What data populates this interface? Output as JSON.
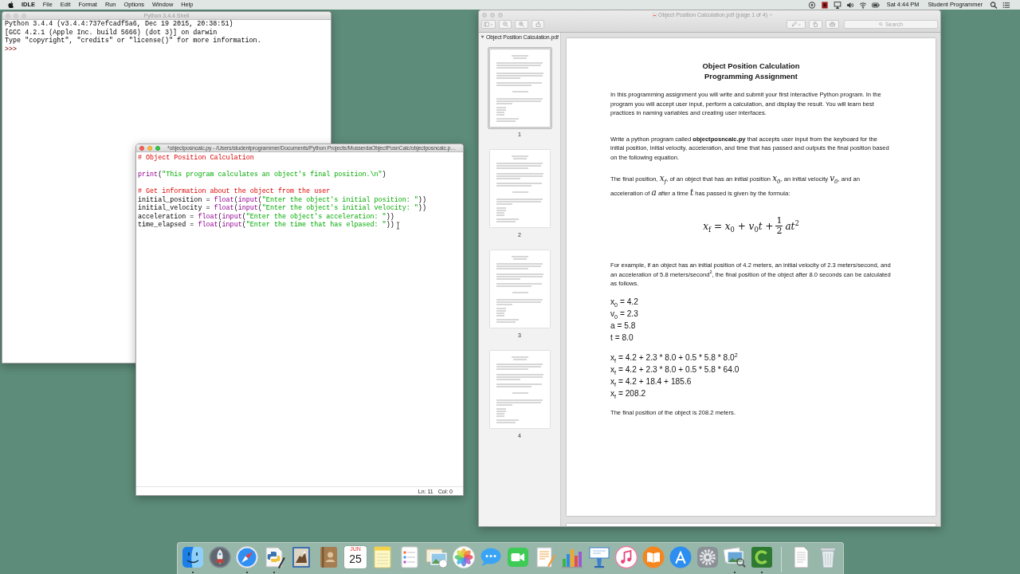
{
  "menu_bar": {
    "app": "IDLE",
    "menus": [
      "File",
      "Edit",
      "Format",
      "Run",
      "Options",
      "Window",
      "Help"
    ],
    "clock": "Sat 4:44 PM",
    "user": "Student Programmer"
  },
  "shell": {
    "title": "Python 3.4.4 Shell",
    "active": false,
    "lines": [
      "Python 3.4.4 (v3.4.4:737efcadf5a6, Dec 19 2015, 20:38:51)",
      "[GCC 4.2.1 (Apple Inc. build 5666) (dot 3)] on darwin",
      "Type \"copyright\", \"credits\" or \"license()\" for more information."
    ],
    "prompt": ">>>"
  },
  "editor": {
    "title": "*objectposncalc.py - /Users/studentprogrammer/Documents/Python Projects/MusserdaObjectPosnCalc/objectposncalc.p…",
    "active": true,
    "blocks": [
      [
        [
          {
            "kind": "comment",
            "text": "# Object Position Calculation"
          }
        ]
      ],
      [
        [
          {
            "kind": "builtin",
            "text": "print"
          },
          {
            "kind": "plain",
            "text": "("
          },
          {
            "kind": "string",
            "text": "\"This program calculates an object's final position.\\n\""
          },
          {
            "kind": "plain",
            "text": ")"
          }
        ]
      ],
      [
        [
          {
            "kind": "comment",
            "text": "# Get information about the object from the user"
          }
        ],
        [
          {
            "kind": "plain",
            "text": "initial_position = "
          },
          {
            "kind": "builtin",
            "text": "float"
          },
          {
            "kind": "plain",
            "text": "("
          },
          {
            "kind": "builtin",
            "text": "input"
          },
          {
            "kind": "plain",
            "text": "("
          },
          {
            "kind": "string",
            "text": "\"Enter the object's initial position: \""
          },
          {
            "kind": "plain",
            "text": "))"
          }
        ],
        [
          {
            "kind": "plain",
            "text": "initial_velocity = "
          },
          {
            "kind": "builtin",
            "text": "float"
          },
          {
            "kind": "plain",
            "text": "("
          },
          {
            "kind": "builtin",
            "text": "input"
          },
          {
            "kind": "plain",
            "text": "("
          },
          {
            "kind": "string",
            "text": "\"Enter the object's initial velocity: \""
          },
          {
            "kind": "plain",
            "text": "))"
          }
        ],
        [
          {
            "kind": "plain",
            "text": "acceleration = "
          },
          {
            "kind": "builtin",
            "text": "float"
          },
          {
            "kind": "plain",
            "text": "("
          },
          {
            "kind": "builtin",
            "text": "input"
          },
          {
            "kind": "plain",
            "text": "("
          },
          {
            "kind": "string",
            "text": "\"Enter the object's acceleration: \""
          },
          {
            "kind": "plain",
            "text": "))"
          }
        ],
        [
          {
            "kind": "plain",
            "text": "time_elapsed = "
          },
          {
            "kind": "builtin",
            "text": "float"
          },
          {
            "kind": "plain",
            "text": "("
          },
          {
            "kind": "builtin",
            "text": "input"
          },
          {
            "kind": "plain",
            "text": "("
          },
          {
            "kind": "string",
            "text": "\"Enter the time that has elpased: \""
          },
          {
            "kind": "plain",
            "text": "))"
          }
        ]
      ]
    ],
    "status": {
      "line": "Ln: 11",
      "column": "Col: 0"
    }
  },
  "preview": {
    "title": "Object Position Calculation.pdf (page 1 of 4)",
    "active": false,
    "search": {
      "placeholder": "Search"
    },
    "sidebar": {
      "document": "Object Position Calculation.pdf",
      "expanded": true,
      "pages": [
        {
          "label": "1",
          "selected": true
        },
        {
          "label": "2",
          "selected": false
        },
        {
          "label": "3",
          "selected": false
        },
        {
          "label": "4",
          "selected": false
        }
      ]
    },
    "page": {
      "title": "Object Position Calculation",
      "subtitle": "Programming Assignment",
      "content": [
        {
          "kind": "paragraph",
          "text": "In this programming assignment you will write and submit your first interactive Python program. In the program you will accept user input, perform a calculation, and display the result. You will learn best practices in naming variables and creating user interfaces."
        },
        {
          "kind": "paragraph",
          "text": "Write a python program called **objectposncalc.py** that accepts user input from the keyboard for the initial position, initial velocity, acceleration, and time that has passed and outputs the final position based on the following equation."
        },
        {
          "kind": "paragraph",
          "text": "The final position, *x*$_{f}$, of an object that has an initial position *x*$_{0}$, an initial velocity *v*$_{0}$, and an acceleration of *a* after a time *t* has passed is given by the formula:"
        },
        {
          "kind": "equation",
          "left": "*x*$_{f}$ = *x*$_{0}$ + *v*$_{0}$*t* +",
          "numerator": "1",
          "denominator": "2",
          "right": "*at*$^{2}$"
        },
        {
          "kind": "paragraph",
          "text": "For example, if an object has an initial position of 4.2 meters, an initial velocity of 2.3 meters/second, and an acceleration of 5.8 meters/second$^{2}$, the final position of the object after 8.0 seconds can be calculated as follows."
        },
        {
          "kind": "lines",
          "lines": [
            "x$_{0}$ = 4.2",
            "v$_{0}$ = 2.3",
            "a = 5.8",
            "t = 8.0"
          ]
        },
        {
          "kind": "lines",
          "lines": [
            "x$_{f}$ = 4.2 + 2.3 * 8.0 + 0.5 * 5.8 * 8.0$^{2}$",
            "x$_{f}$ = 4.2 + 2.3 * 8.0 + 0.5 * 5.8 * 64.0",
            "x$_{f}$ = 4.2 + 18.4 + 185.6",
            "x$_{f}$ = 208.2"
          ]
        },
        {
          "kind": "paragraph",
          "text": "The final position of the object is 208.2 meters."
        }
      ]
    }
  },
  "dock": {
    "apps": [
      {
        "kind": "face",
        "running": true
      },
      {
        "kind": "rocket",
        "running": false
      },
      {
        "kind": "compass",
        "running": true
      },
      {
        "kind": "script",
        "running": true
      },
      {
        "kind": "bird",
        "running": false
      },
      {
        "kind": "addressbook",
        "running": false
      },
      {
        "kind": "calendar",
        "running": false,
        "month": "JUN",
        "day": "25"
      },
      {
        "kind": "notepad",
        "running": false
      },
      {
        "kind": "checklist",
        "running": false
      },
      {
        "kind": "collage",
        "running": false
      },
      {
        "kind": "flower",
        "running": false
      },
      {
        "kind": "bubble",
        "running": false
      },
      {
        "kind": "camera",
        "running": false
      },
      {
        "kind": "writer",
        "running": false
      },
      {
        "kind": "chart",
        "running": false
      },
      {
        "kind": "podium",
        "running": false
      },
      {
        "kind": "note",
        "running": false
      },
      {
        "kind": "book",
        "running": false
      },
      {
        "kind": "tools",
        "running": false
      },
      {
        "kind": "gear",
        "running": false
      },
      {
        "kind": "viewer",
        "running": true
      },
      {
        "kind": "arc",
        "running": true
      }
    ],
    "others": [
      {
        "kind": "document",
        "running": false
      },
      {
        "kind": "trash",
        "running": false
      }
    ]
  }
}
